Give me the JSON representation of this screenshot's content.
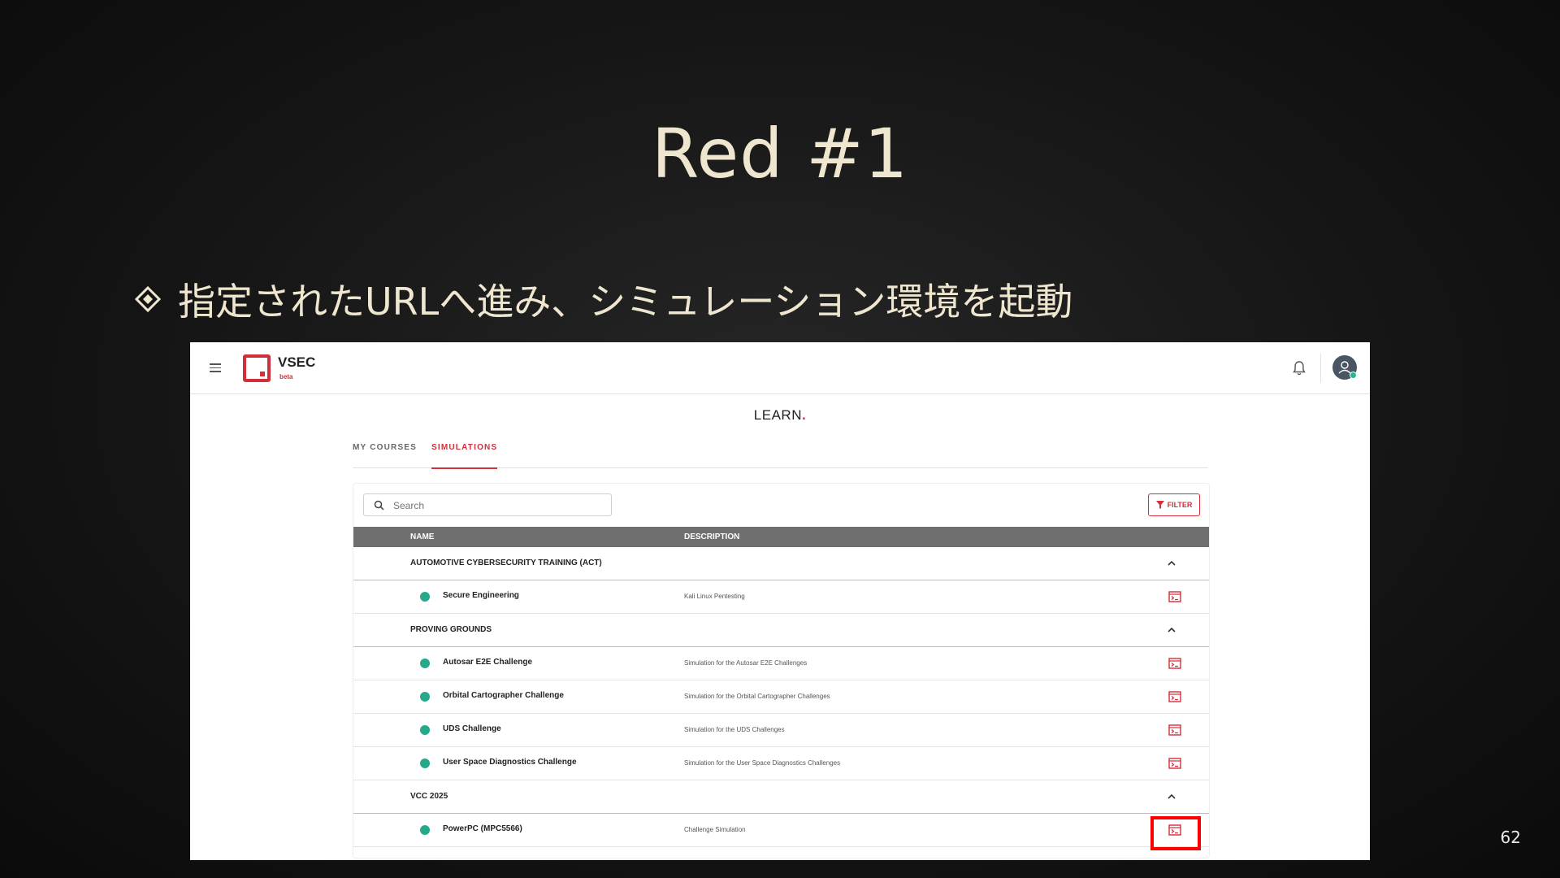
{
  "slide": {
    "title": "Red #1",
    "bullet": "指定されたURLへ進み、シミュレーション環境を起動",
    "page_number": "62"
  },
  "app": {
    "brand": "VSEC",
    "beta": "beta",
    "page_title": "LEARN",
    "page_title_dot": ".",
    "tabs": [
      {
        "label": "MY COURSES",
        "active": false
      },
      {
        "label": "SIMULATIONS",
        "active": true
      }
    ],
    "search": {
      "placeholder": "Search",
      "value": ""
    },
    "filter_label": "FILTER",
    "columns": [
      "NAME",
      "DESCRIPTION"
    ],
    "groups": [
      {
        "name": "AUTOMOTIVE CYBERSECURITY TRAINING (ACT)",
        "items": [
          {
            "name": "Secure Engineering",
            "description": "Kali Linux Pentesting"
          }
        ]
      },
      {
        "name": "PROVING GROUNDS",
        "items": [
          {
            "name": "Autosar E2E Challenge",
            "description": "Simulation for the Autosar E2E Challenges"
          },
          {
            "name": "Orbital Cartographer Challenge",
            "description": "Simulation for the Orbital Cartographer Challenges"
          },
          {
            "name": "UDS Challenge",
            "description": "Simulation for the UDS Challenges"
          },
          {
            "name": "User Space Diagnostics Challenge",
            "description": "Simulation for the User Space Diagnostics Challenges"
          }
        ]
      },
      {
        "name": "VCC 2025",
        "items": [
          {
            "name": "PowerPC (MPC5566)",
            "description": "Challenge Simulation"
          }
        ]
      }
    ],
    "colors": {
      "accent": "#d32f3a",
      "status": "#26a98b",
      "header": "#6f6f6f",
      "highlight": "#ff0000"
    }
  }
}
